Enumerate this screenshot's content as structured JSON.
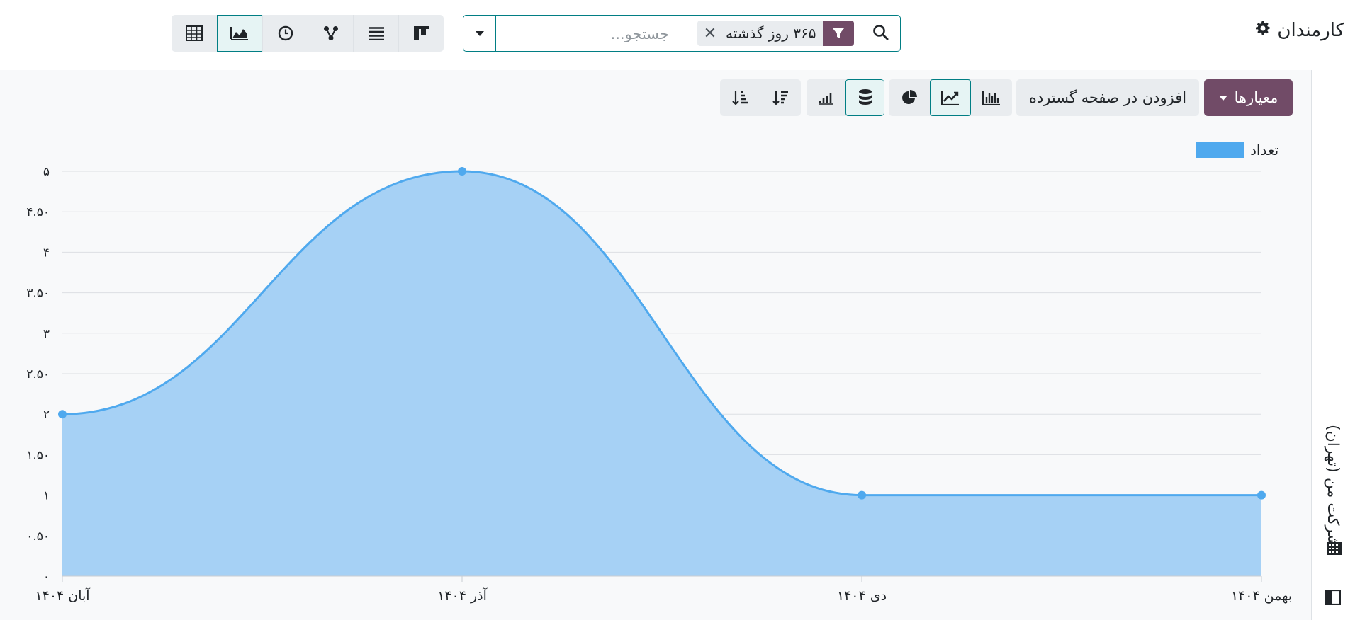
{
  "app": {
    "title": "کارمندان",
    "settings_icon": "gear-icon"
  },
  "search": {
    "placeholder": "جستجو...",
    "facet_label": "۳۶۵ روز گذشته",
    "facet_icon": "filter-icon",
    "remove_icon": "close-icon"
  },
  "views": [
    {
      "name": "kanban-view-button",
      "icon": "kanban-icon",
      "active": false
    },
    {
      "name": "list-view-button",
      "icon": "list-icon",
      "active": false
    },
    {
      "name": "hierarchy-view-button",
      "icon": "hierarchy-icon",
      "active": false
    },
    {
      "name": "activity-view-button",
      "icon": "clock-icon",
      "active": false
    },
    {
      "name": "graph-view-button",
      "icon": "area-chart-icon",
      "active": true
    },
    {
      "name": "pivot-view-button",
      "icon": "table-icon",
      "active": false
    }
  ],
  "toolbar": {
    "measures_label": "معیارها",
    "add_to_dashboard_label": "افزودن در صفحه گسترده",
    "chart_types": [
      "bar-chart-icon",
      "line-chart-icon",
      "pie-chart-icon"
    ],
    "active_chart_type": "line-chart-icon",
    "options": [
      "stacked-icon",
      "cumulative-icon",
      "sort-descending-icon",
      "sort-ascending-icon"
    ],
    "active_option": "stacked-icon"
  },
  "sidebar": {
    "company": "شرکت من (تهران)"
  },
  "colors": {
    "accent": "#714b67",
    "teal": "#017e84",
    "series": "#4fa9ee",
    "fill": "#a6d1f5"
  },
  "chart_data": {
    "type": "line",
    "filled": true,
    "categories": [
      "آبان ۱۴۰۴",
      "آذر ۱۴۰۴",
      "دی ۱۴۰۴",
      "بهمن ۱۴۰۴"
    ],
    "series": [
      {
        "name": "تعداد",
        "values": [
          2,
          5,
          1,
          1
        ]
      }
    ],
    "ylim": [
      0,
      5
    ],
    "yticks": [
      0,
      0.5,
      1,
      1.5,
      2,
      2.5,
      3,
      3.5,
      4,
      4.5,
      5
    ],
    "ytick_labels": [
      "۰",
      "۰.۵۰",
      "۱",
      "۱.۵۰",
      "۲",
      "۲.۵۰",
      "۳",
      "۳.۵۰",
      "۴",
      "۴.۵۰",
      "۵"
    ],
    "grid": true,
    "legend_position": "top-right"
  }
}
